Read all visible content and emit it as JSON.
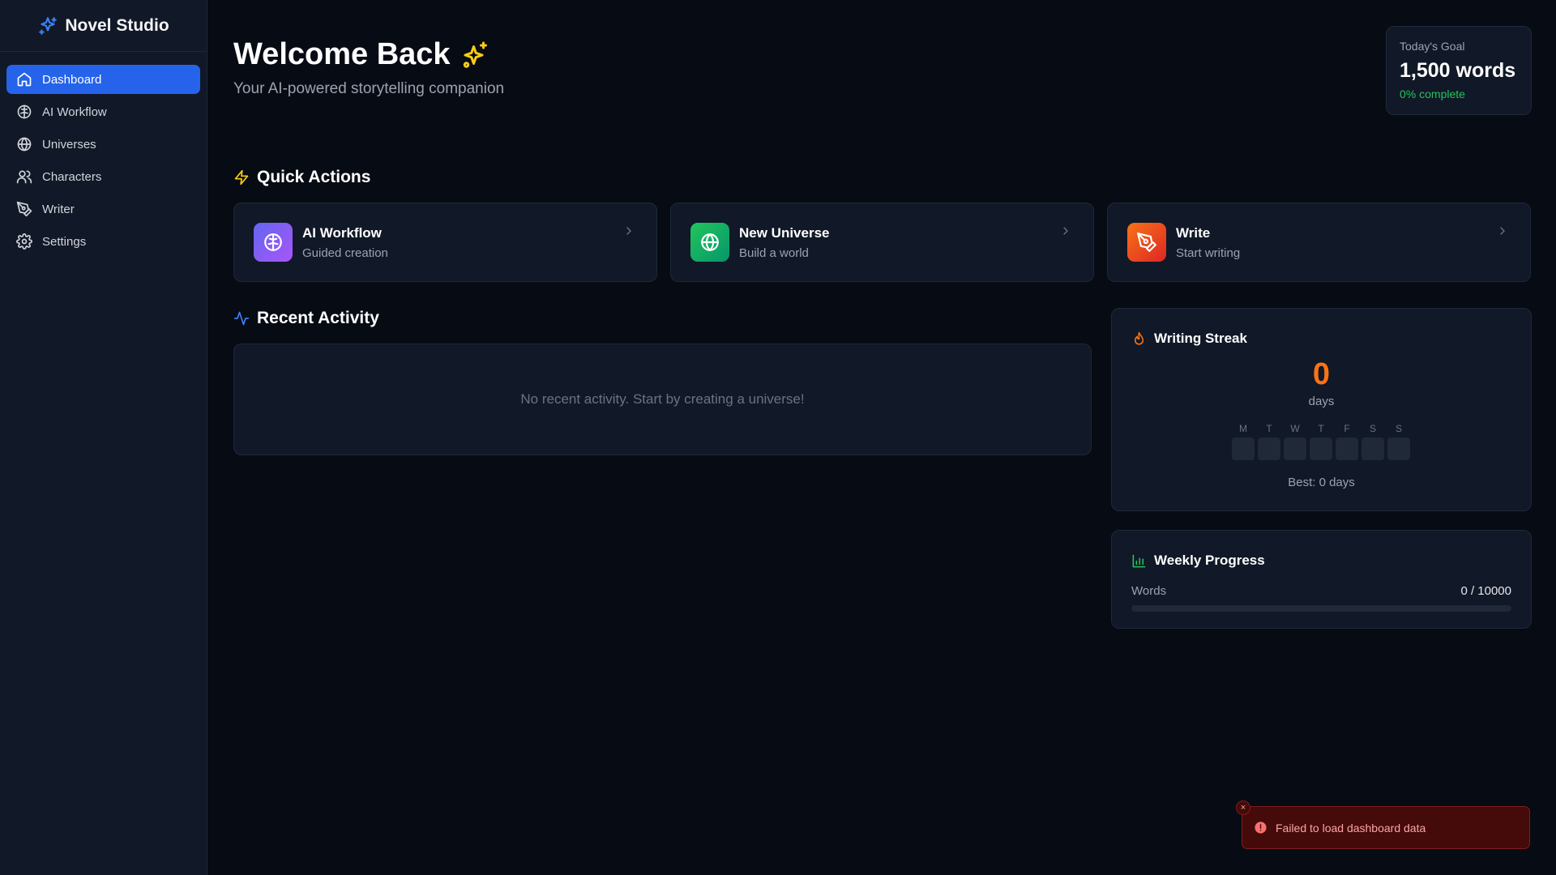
{
  "app": {
    "name": "Novel Studio",
    "logo_icon": "sparkles-icon"
  },
  "sidebar": {
    "items": [
      {
        "label": "Dashboard",
        "icon": "home-icon",
        "active": true
      },
      {
        "label": "AI Workflow",
        "icon": "brain-icon"
      },
      {
        "label": "Universes",
        "icon": "globe-icon"
      },
      {
        "label": "Characters",
        "icon": "users-icon"
      },
      {
        "label": "Writer",
        "icon": "pen-tool-icon"
      },
      {
        "label": "Settings",
        "icon": "gear-icon"
      }
    ]
  },
  "header": {
    "title": "Welcome Back",
    "title_icon": "sparkles-icon",
    "subtitle": "Your AI-powered storytelling companion"
  },
  "goal": {
    "label": "Today's Goal",
    "value": "1,500 words",
    "progress_text": "0% complete"
  },
  "quick_actions": {
    "title": "Quick Actions",
    "icon": "zap-icon",
    "items": [
      {
        "title": "AI Workflow",
        "subtitle": "Guided creation",
        "icon": "brain-icon"
      },
      {
        "title": "New Universe",
        "subtitle": "Build a world",
        "icon": "globe-icon"
      },
      {
        "title": "Write",
        "subtitle": "Start writing",
        "icon": "pen-tool-icon"
      }
    ]
  },
  "recent_activity": {
    "title": "Recent Activity",
    "icon": "activity-icon",
    "empty_text": "No recent activity. Start by creating a universe!"
  },
  "writing_streak": {
    "title": "Writing Streak",
    "icon": "flame-icon",
    "count": "0",
    "unit": "days",
    "days": [
      "M",
      "T",
      "W",
      "T",
      "F",
      "S",
      "S"
    ],
    "best": "Best: 0 days"
  },
  "weekly_progress": {
    "title": "Weekly Progress",
    "icon": "bar-chart-icon",
    "label": "Words",
    "value": "0 / 10000",
    "fraction": 0
  },
  "toast": {
    "message": "Failed to load dashboard data",
    "icon": "alert-circle-icon",
    "close": "×"
  },
  "colors": {
    "accent": "#2563eb",
    "background": "#070b14",
    "card": "#111827",
    "streak": "#f97316",
    "success": "#22c55e",
    "error": "#450a0a"
  }
}
